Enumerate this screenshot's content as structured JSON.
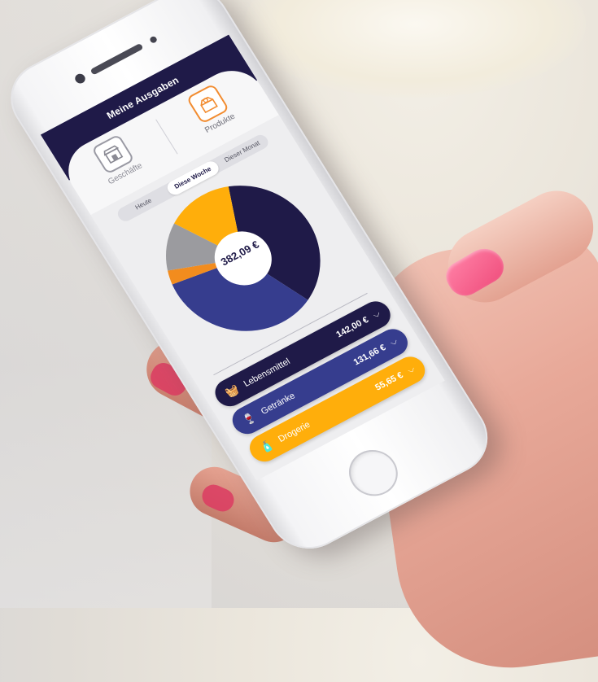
{
  "app": {
    "title": "Meine Ausgaben"
  },
  "tabs": [
    {
      "label": "Geschäfte",
      "icon": "storefront-icon"
    },
    {
      "label": "Produkte",
      "icon": "product-box-icon"
    }
  ],
  "period": {
    "options": [
      "Heute",
      "Diese Woche",
      "Dieser Monat"
    ],
    "selected": "Diese Woche"
  },
  "summary": {
    "total": "382,09 €"
  },
  "chart_data": {
    "type": "pie",
    "total_label": "382,09 €",
    "slices": [
      {
        "name": "Lebensmittel",
        "value": 142.0,
        "color": "#1f1a48",
        "icon": "grocery-basket-icon"
      },
      {
        "name": "Getränke",
        "value": 131.66,
        "color": "#363d8e",
        "icon": "bottle-glass-icon"
      },
      {
        "name": "",
        "value": 12.0,
        "color": "#f28c1e",
        "icon": "tshirt-icon"
      },
      {
        "name": "",
        "value": 40.78,
        "color": "#9b9b9f",
        "icon": "sofa-icon"
      },
      {
        "name": "Drogerie",
        "value": 55.65,
        "color": "#ffae0b",
        "icon": "drugstore-icon"
      }
    ]
  },
  "categories": [
    {
      "name": "Lebensmittel",
      "amount": "142,00 €",
      "icon": "grocery-basket-icon",
      "color": "#1f1a48"
    },
    {
      "name": "Getränke",
      "amount": "131,66 €",
      "icon": "bottle-glass-icon",
      "color": "#363d8e"
    },
    {
      "name": "Drogerie",
      "amount": "55,65 €",
      "icon": "drugstore-icon",
      "color": "#ffae0b"
    }
  ]
}
